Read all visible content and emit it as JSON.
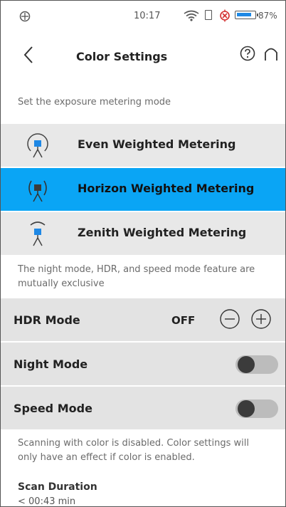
{
  "status_bar": {
    "time": "10:17",
    "battery_percent": "87%",
    "icons": [
      "app-logo-icon",
      "wifi-icon",
      "sim-icon",
      "alert-icon",
      "battery-icon"
    ]
  },
  "header": {
    "title": "Color Settings",
    "back_icon": "chevron-left-icon",
    "help_icon": "question-circle-icon",
    "home_icon": "home-arch-icon"
  },
  "metering": {
    "caption": "Set the exposure metering mode",
    "options": [
      {
        "label": "Even Weighted Metering",
        "selected": false
      },
      {
        "label": "Horizon Weighted Metering",
        "selected": true
      },
      {
        "label": "Zenith Weighted Metering",
        "selected": false
      }
    ]
  },
  "modes": {
    "caption": "The night mode, HDR, and speed mode feature are mutually exclusive",
    "hdr": {
      "label": "HDR Mode",
      "value": "OFF"
    },
    "night": {
      "label": "Night Mode",
      "enabled": false
    },
    "speed": {
      "label": "Speed Mode",
      "enabled": false
    }
  },
  "color_note": "Scanning with color is disabled. Color settings will only have an effect if color is enabled.",
  "scan": {
    "title": "Scan Duration",
    "value": "< 00:43 min"
  },
  "colors": {
    "selected": "#0aa5f5",
    "row_bg": "#e3e3e3",
    "icon_blue": "#1e88e5"
  }
}
